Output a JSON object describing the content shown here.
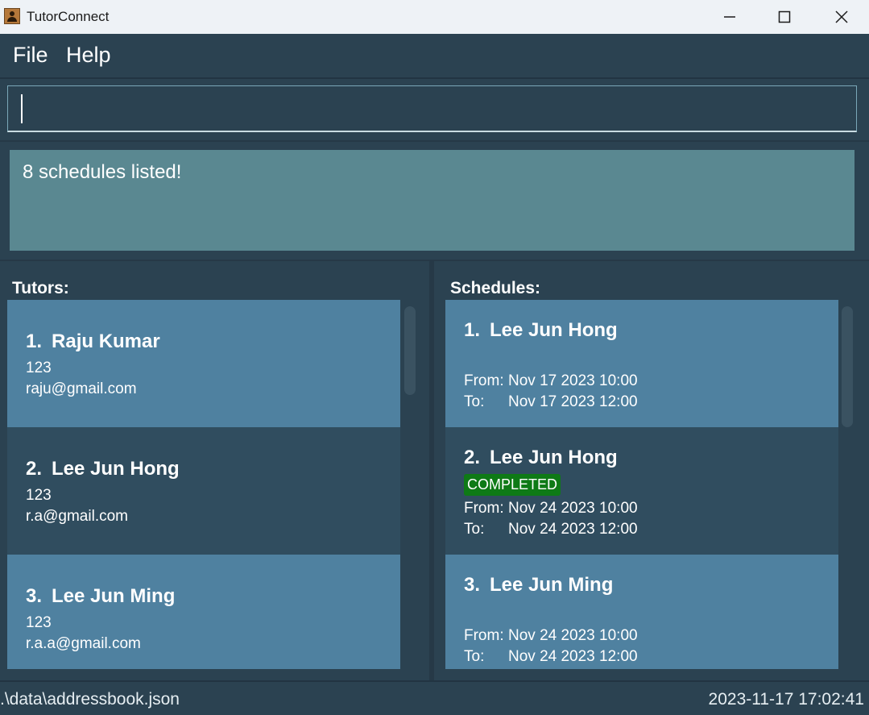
{
  "window": {
    "title": "TutorConnect"
  },
  "menu": {
    "file": "File",
    "help": "Help"
  },
  "command": {
    "value": "",
    "placeholder": ""
  },
  "result": {
    "message": "8 schedules listed!"
  },
  "tutors": {
    "title": "Tutors:",
    "items": [
      {
        "index": "1.",
        "name": "Raju Kumar",
        "phone": "123",
        "email": "raju@gmail.com"
      },
      {
        "index": "2.",
        "name": "Lee Jun Hong",
        "phone": "123",
        "email": "r.a@gmail.com"
      },
      {
        "index": "3.",
        "name": "Lee Jun Ming",
        "phone": "123",
        "email": "r.a.a@gmail.com"
      }
    ]
  },
  "schedules": {
    "title": "Schedules:",
    "from_label": "From:",
    "to_label": "To:",
    "items": [
      {
        "index": "1.",
        "name": "Lee Jun Hong",
        "status": "",
        "from": "Nov 17 2023 10:00",
        "to": "Nov 17 2023 12:00"
      },
      {
        "index": "2.",
        "name": "Lee Jun Hong",
        "status": "COMPLETED",
        "from": "Nov 24 2023 10:00",
        "to": "Nov 24 2023 12:00"
      },
      {
        "index": "3.",
        "name": "Lee Jun Ming",
        "status": "",
        "from": "Nov 24 2023 10:00",
        "to": "Nov 24 2023 12:00"
      }
    ]
  },
  "status_bar": {
    "path": ".\\data\\addressbook.json",
    "time": "2023-11-17 17:02:41"
  },
  "colors": {
    "completed_badge": "#0e7a16",
    "card_odd": "#4f81a0",
    "card_even": "#304d5f"
  }
}
